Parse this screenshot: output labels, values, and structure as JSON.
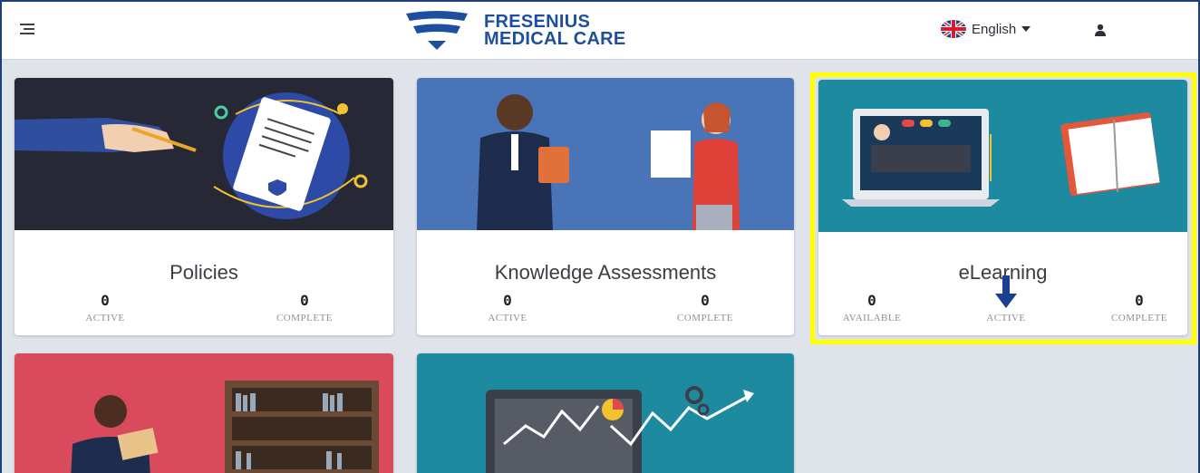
{
  "header": {
    "brand_line1": "FRESENIUS",
    "brand_line2": "MEDICAL CARE",
    "language": "English",
    "icons": {
      "menu": "menu-icon",
      "flag": "uk-flag-icon",
      "user": "user-icon",
      "caret": "chevron-down-icon"
    }
  },
  "cards": [
    {
      "title": "Policies",
      "theme": "#262836",
      "stats": [
        {
          "value": "0",
          "label": "ACTIVE"
        },
        {
          "value": "0",
          "label": "COMPLETE"
        }
      ]
    },
    {
      "title": "Knowledge Assessments",
      "theme": "#4a74b8",
      "stats": [
        {
          "value": "0",
          "label": "ACTIVE"
        },
        {
          "value": "0",
          "label": "COMPLETE"
        }
      ]
    },
    {
      "title": "eLearning",
      "theme": "#1e8aa0",
      "stats": [
        {
          "value": "0",
          "label": "AVAILABLE"
        },
        {
          "value": "",
          "label": "ACTIVE"
        },
        {
          "value": "0",
          "label": "COMPLETE"
        }
      ]
    },
    {
      "title": "",
      "theme": "#d94a5c",
      "stats": []
    },
    {
      "title": "",
      "theme": "#1e8aa0",
      "stats": []
    }
  ],
  "colors": {
    "highlight": "#ffff00",
    "brand": "#1d4f9e",
    "annotation_arrow": "#1c3f8f"
  }
}
